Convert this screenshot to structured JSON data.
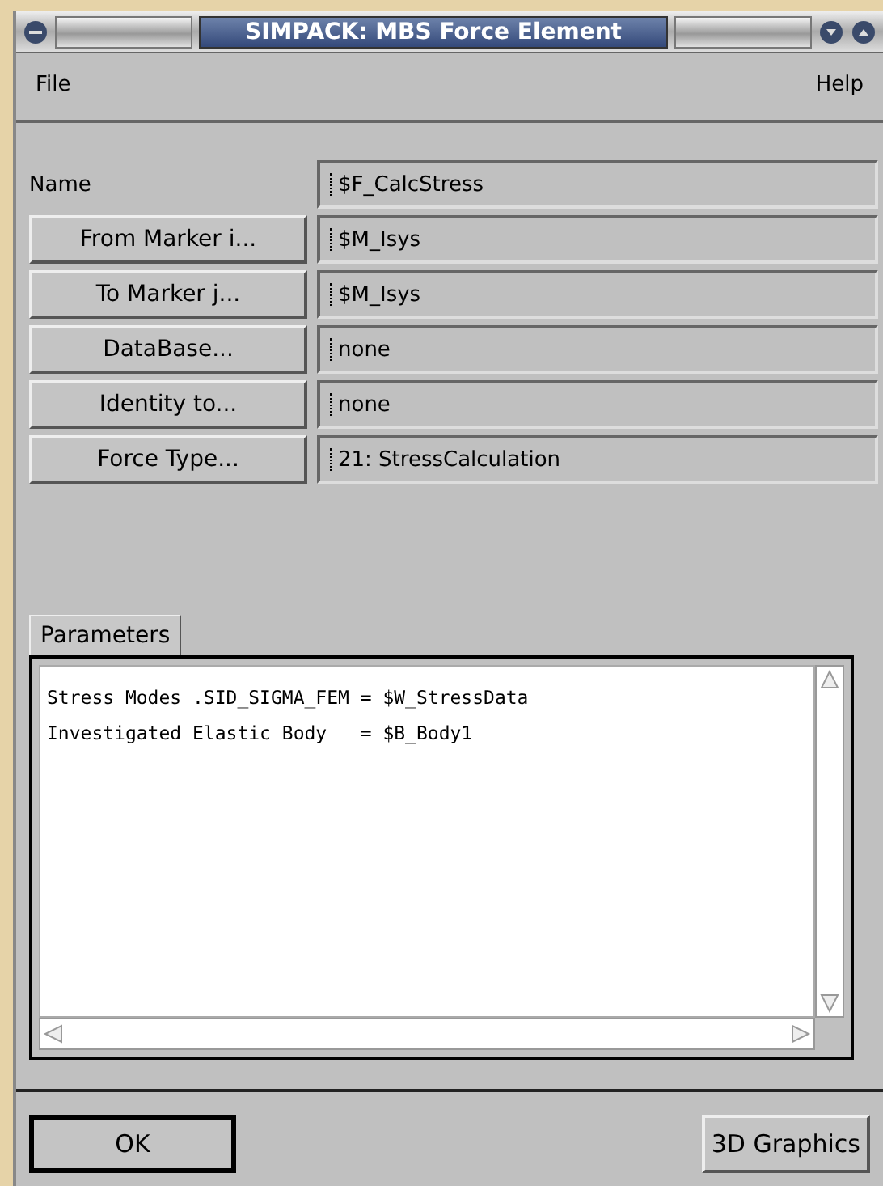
{
  "window": {
    "title": "SIMPACK: MBS Force Element"
  },
  "menu": [
    "File",
    "Help"
  ],
  "fields": [
    {
      "kind": "label",
      "label": "Name",
      "value": "$F_CalcStress"
    },
    {
      "kind": "button",
      "label": "From Marker i...",
      "value": "$M_Isys"
    },
    {
      "kind": "button",
      "label": "To Marker j...",
      "value": "$M_Isys"
    },
    {
      "kind": "button",
      "label": "DataBase...",
      "value": "none"
    },
    {
      "kind": "button",
      "label": "Identity to...",
      "value": "none"
    },
    {
      "kind": "button",
      "label": "Force Type...",
      "value": "21: StressCalculation"
    }
  ],
  "tabs": [
    {
      "label": "Parameters",
      "selected": true
    }
  ],
  "parameters": [
    "Stress Modes .SID_SIGMA_FEM = $W_StressData",
    "Investigated Elastic Body   = $B_Body1"
  ],
  "buttons": [
    {
      "label": "OK",
      "default": true
    },
    {
      "label": "3D Graphics",
      "default": false
    }
  ]
}
